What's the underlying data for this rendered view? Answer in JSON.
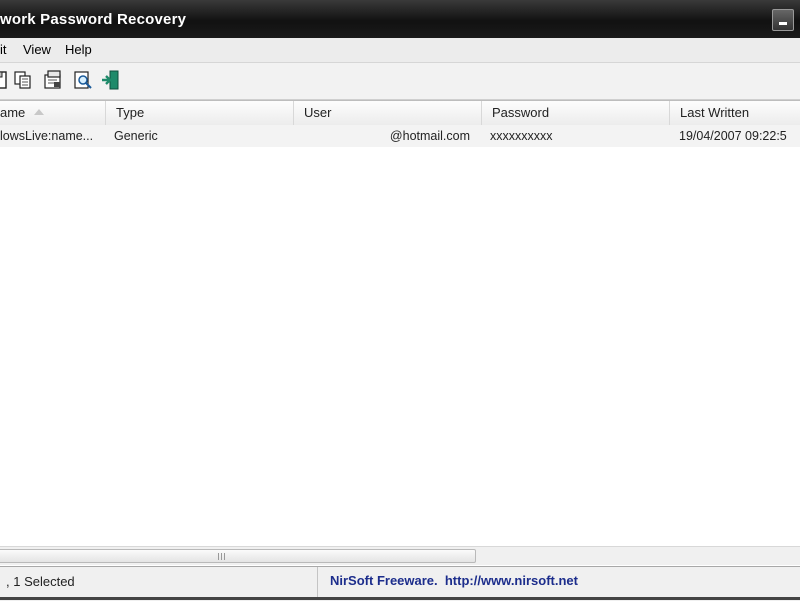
{
  "window": {
    "title": "work Password Recovery"
  },
  "menu": {
    "items": [
      {
        "label": "it"
      },
      {
        "label": "View"
      },
      {
        "label": "Help"
      }
    ]
  },
  "toolbar": {
    "icons": [
      "save-icon",
      "copy-icon",
      "properties-icon",
      "find-icon",
      "exit-icon"
    ]
  },
  "table": {
    "columns": [
      {
        "label": "ame"
      },
      {
        "label": "Type"
      },
      {
        "label": "User"
      },
      {
        "label": "Password"
      },
      {
        "label": "Last Written"
      }
    ],
    "rows": [
      {
        "name": "lowsLive:name...",
        "type": "Generic",
        "user": "@hotmail.com",
        "password": "xxxxxxxxxx",
        "last_written": "19/04/2007 09:22:5"
      }
    ]
  },
  "status": {
    "count": ", 1 Selected",
    "credit": "NirSoft Freeware.  http://www.nirsoft.net"
  },
  "colors": {
    "titlebar": "#1a1a1a",
    "status_link": "#1c2d8c"
  }
}
